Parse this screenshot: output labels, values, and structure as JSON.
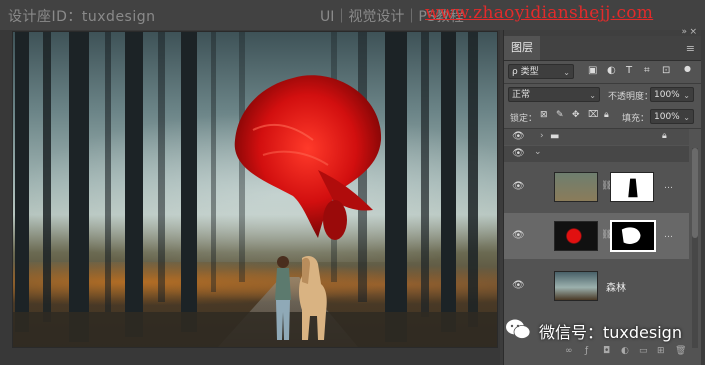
{
  "watermark": {
    "site_left": "设计座ID：tuxdesign",
    "category": "UI｜视觉设计｜PS教程",
    "url": "www.zhaoyidianshejj.com"
  },
  "canvas": {
    "scene": "forest-photo-composite"
  },
  "panel": {
    "tab_label": "图层",
    "menu_icon": "hamburger-icon",
    "filter": {
      "value": "ρ 类型"
    },
    "blend_mode": {
      "value": "正常"
    },
    "opacity": {
      "label": "不透明度：",
      "value": "100%"
    },
    "lock": {
      "label": "锁定："
    },
    "fill": {
      "label": "填充：",
      "value": "100%"
    },
    "layers": [
      {
        "name": "",
        "kind": "group",
        "visible": true,
        "locked": true
      },
      {
        "name": "",
        "kind": "group-open",
        "visible": true
      },
      {
        "name": "",
        "kind": "horse-with-mask",
        "visible": true
      },
      {
        "name": "",
        "kind": "fish-with-mask",
        "visible": true,
        "selected": true
      },
      {
        "name": "森林",
        "kind": "forest",
        "visible": true
      }
    ],
    "colors": {
      "panel_bg": "#535353",
      "selected_bg": "#686868"
    }
  },
  "overlay": {
    "wechat_text": "微信号：tuxdesign"
  }
}
